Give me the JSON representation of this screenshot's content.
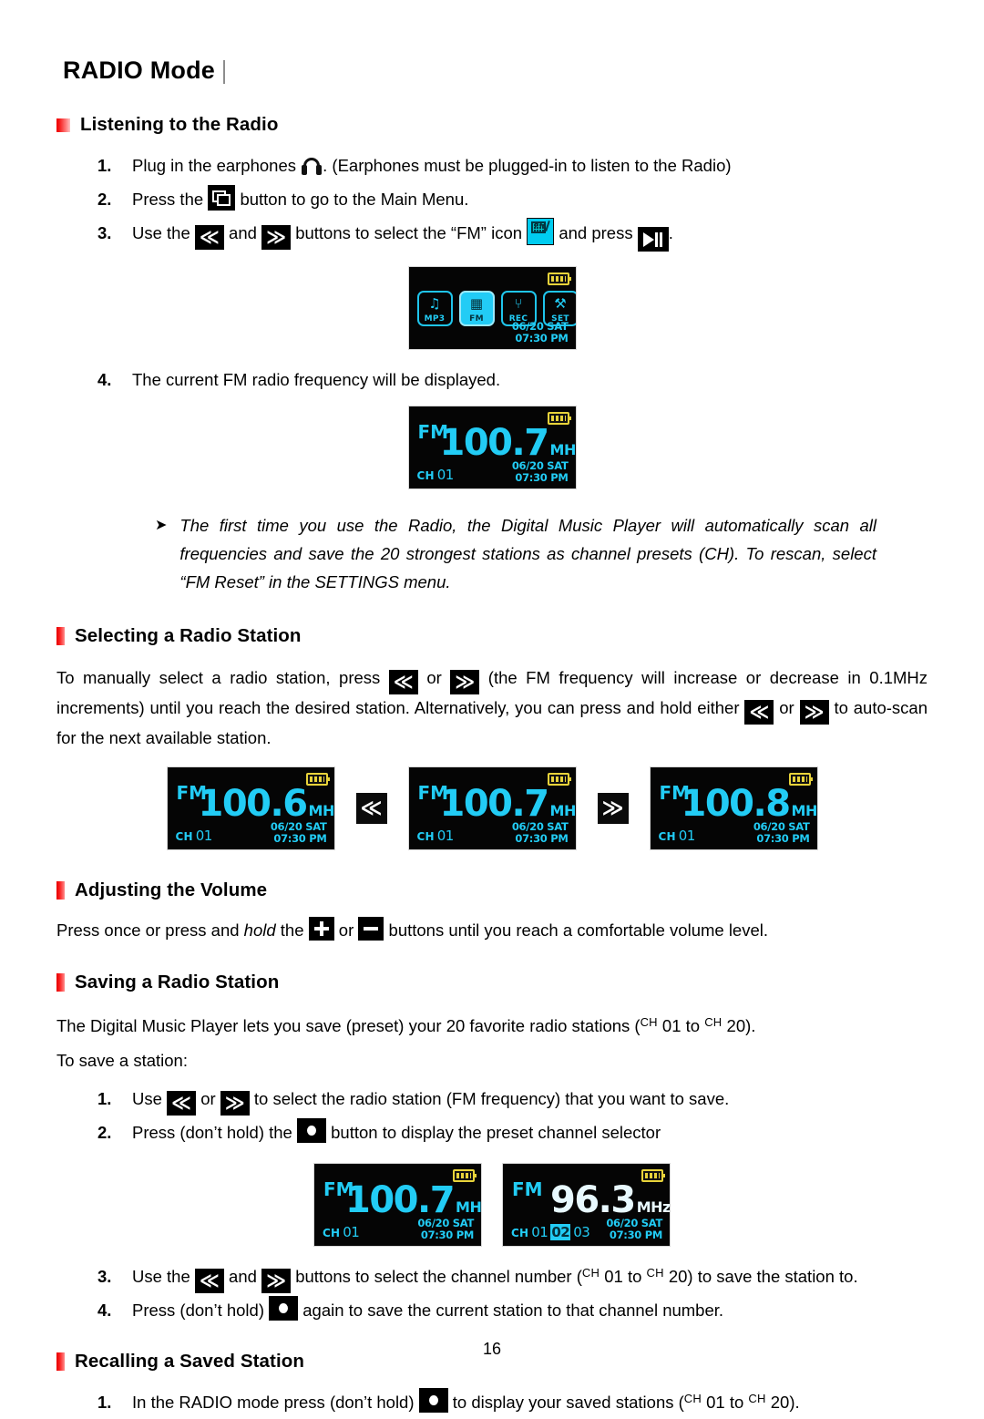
{
  "document": {
    "title": "RADIO Mode",
    "page_number": "16"
  },
  "sections": {
    "listening": {
      "heading": "Listening to the Radio",
      "steps": [
        {
          "num": "1.",
          "text_before": "Plug in the earphones",
          "text_after": ". (Earphones must be plugged-in to listen to the Radio)"
        },
        {
          "num": "2.",
          "text_before": "Press the",
          "text_after": "button to go to the Main Menu."
        },
        {
          "num": "3.",
          "part1": "Use the",
          "part2": "and",
          "part3": "buttons to select the “FM” icon",
          "part4": "and press",
          "part5": "."
        },
        {
          "num": "4.",
          "text": "The current FM radio frequency will be displayed."
        }
      ],
      "note": {
        "marker": "➤",
        "text": "The first time you use the Radio, the Digital Music Player will automatically scan all frequencies and save the 20 strongest stations as channel presets (CH). To rescan, select “FM Reset” in the SETTINGS menu."
      }
    },
    "selecting": {
      "heading": "Selecting a Radio Station",
      "para_1": "To manually select a radio station, press",
      "para_2": "or",
      "para_3": "(the FM frequency will increase or decrease in 0.1MHz increments) until you reach the desired station. Alternatively, you can press and hold either",
      "para_4": "or",
      "para_5": "to auto-scan for the next available station."
    },
    "volume": {
      "heading": "Adjusting the Volume",
      "para_1": "Press once or press and",
      "para_hold": "hold",
      "para_2": "the",
      "para_3": "or",
      "para_4": "buttons until you reach a comfortable volume level."
    },
    "saving": {
      "heading": "Saving a Radio Station",
      "intro_1": "The Digital Music Player lets you save (preset) your 20 favorite radio stations (",
      "intro_ch1": "CH",
      "intro_n1": "01 to",
      "intro_ch2": "CH",
      "intro_n2": "20).",
      "intro_2": "To save a station:",
      "steps": [
        {
          "num": "1.",
          "part1": "Use",
          "part2": "or",
          "part3": "to select the radio station (FM frequency) that you want to save."
        },
        {
          "num": "2.",
          "part1": "Press (don’t hold) the",
          "part2": "button to display the preset channel selector"
        },
        {
          "num": "3.",
          "part1": "Use the",
          "part2": "and",
          "part3": "buttons to select the channel number (",
          "ch1": "CH",
          "n1": "01 to",
          "ch2": "CH",
          "n2": "20) to save the station to."
        },
        {
          "num": "4.",
          "part1": "Press (don’t hold)",
          "part2": "again to save the current station to that channel number."
        }
      ]
    },
    "recalling": {
      "heading": "Recalling a Saved Station",
      "steps": [
        {
          "num": "1.",
          "part1": "In the RADIO mode press (don’t hold)",
          "part2": "to display your saved stations (",
          "ch1": "CH",
          "n1": "01 to",
          "ch2": "CH",
          "n2": "20)."
        }
      ]
    }
  },
  "lcd": {
    "main_menu": {
      "icons": [
        {
          "label": "MP3",
          "glyph": "♫",
          "active": false
        },
        {
          "label": "FM",
          "glyph": "▦",
          "active": true
        },
        {
          "label": "REC",
          "glyph": "⑂",
          "active": false
        },
        {
          "label": "SET",
          "glyph": "⚒",
          "active": false
        }
      ],
      "date": "06/20 SAT",
      "time": "07:30 PM"
    },
    "screens": {
      "fm_main": {
        "fm": "FM",
        "freq": "100.7",
        "unit": "MHz",
        "ch_label": "CH",
        "ch_value": "01",
        "date": "06/20 SAT",
        "time": "07:30 PM"
      },
      "fm_1006": {
        "fm": "FM",
        "freq": "100.6",
        "unit": "MHz",
        "ch_label": "CH",
        "ch_value": "01",
        "date": "06/20 SAT",
        "time": "07:30 PM"
      },
      "fm_1007": {
        "fm": "FM",
        "freq": "100.7",
        "unit": "MHz",
        "ch_label": "CH",
        "ch_value": "01",
        "date": "06/20 SAT",
        "time": "07:30 PM"
      },
      "fm_1008": {
        "fm": "FM",
        "freq": "100.8",
        "unit": "MHz",
        "ch_label": "CH",
        "ch_value": "01",
        "date": "06/20 SAT",
        "time": "07:30 PM"
      },
      "save_before": {
        "fm": "FM",
        "freq": "100.7",
        "unit": "MHz",
        "ch_label": "CH",
        "ch_value": "01",
        "date": "06/20 SAT",
        "time": "07:30 PM"
      },
      "save_after": {
        "fm": "FM",
        "freq": "96.3",
        "unit": "MHz",
        "ch_label": "CH",
        "ch_1": "01",
        "ch_2": "02",
        "ch_3": "03",
        "date": "06/20 SAT",
        "time": "07:30 PM"
      }
    }
  },
  "keys": {
    "prev": "≪",
    "next": "≫"
  },
  "colors": {
    "bullet_red": "#ee0000",
    "lcd_cyan": "#22ccf5",
    "lcd_background": "#050505",
    "battery_yellow": "#e8d33a"
  }
}
